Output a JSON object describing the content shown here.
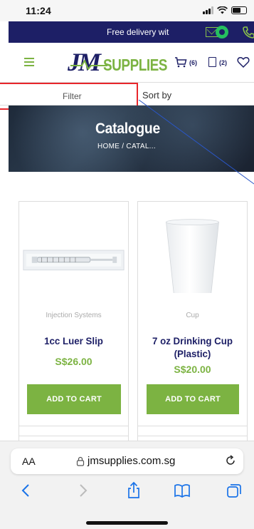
{
  "status_bar": {
    "time": "11:24"
  },
  "promo": {
    "text": "Free delivery wit"
  },
  "header": {
    "logo_jm": "JM",
    "logo_supplies": "SUPPLIES",
    "cart_count": "(6)",
    "quote_count": "(2)"
  },
  "toolbar": {
    "filter_label": "Filter",
    "sort_label": "Sort by"
  },
  "banner": {
    "title": "Catalogue",
    "breadcrumb": "HOME  / CATAL..."
  },
  "products": [
    {
      "category": "Injection Systems",
      "name": "1cc Luer Slip",
      "price": "S$26.00",
      "button": "ADD TO CART"
    },
    {
      "category": "Cup",
      "name": "7 oz Drinking Cup (Plastic)",
      "price": "S$20.00",
      "button": "ADD TO CART"
    }
  ],
  "browser": {
    "text_size": "AA",
    "url": "jmsupplies.com.sg"
  },
  "colors": {
    "navy": "#1d1f66",
    "green": "#7cb342",
    "highlight": "#e8262b"
  },
  "icons": [
    "signal-icon",
    "wifi-icon",
    "battery-icon",
    "mail-icon",
    "whatsapp-icon",
    "phone-icon",
    "hamburger-icon",
    "cart-icon",
    "document-icon",
    "heart-icon",
    "lock-icon",
    "reload-icon",
    "back-icon",
    "forward-icon",
    "share-icon",
    "bookmarks-icon",
    "tabs-icon"
  ]
}
